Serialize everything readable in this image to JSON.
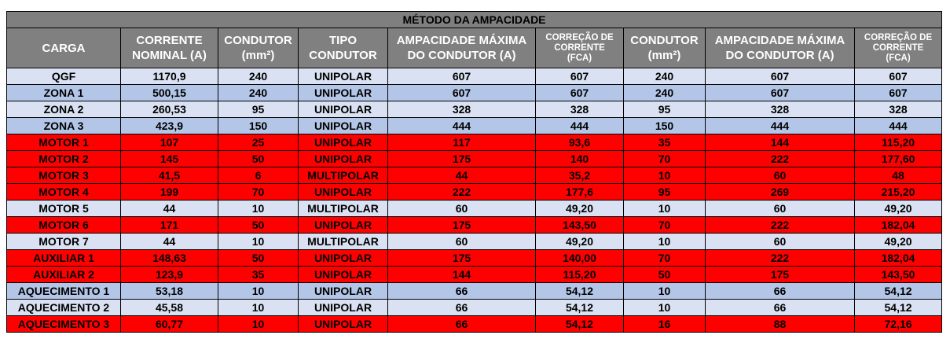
{
  "title": "MÉTODO DA AMPACIDADE",
  "headers": [
    {
      "lines": [
        "CARGA"
      ],
      "small": false
    },
    {
      "lines": [
        "CORRENTE",
        "NOMINAL (A)"
      ],
      "small": false
    },
    {
      "lines": [
        "CONDUTOR",
        "(mm²)"
      ],
      "small": false
    },
    {
      "lines": [
        "TIPO",
        "CONDUTOR"
      ],
      "small": false
    },
    {
      "lines": [
        "AMPACIDADE MÁXIMA",
        "DO CONDUTOR (A)"
      ],
      "small": false
    },
    {
      "lines": [
        "CORREÇÃO DE",
        "CORRENTE",
        "(FCA)"
      ],
      "small": true
    },
    {
      "lines": [
        "CONDUTOR",
        "(mm²)"
      ],
      "small": false
    },
    {
      "lines": [
        "AMPACIDADE MÁXIMA",
        "DO CONDUTOR (A)"
      ],
      "small": false
    },
    {
      "lines": [
        "CORREÇÃO DE",
        "CORRENTE",
        "(FCA)"
      ],
      "small": true
    }
  ],
  "colors": {
    "title_bg": "#7f7f7f",
    "header_bg": "#808080",
    "row_light": "#d9e1f2",
    "row_mid": "#b4c6e7",
    "row_red": "#ff0000"
  },
  "rows": [
    {
      "style": "light",
      "cells": [
        "QGF",
        "1170,9",
        "240",
        "UNIPOLAR",
        "607",
        "607",
        "240",
        "607",
        "607"
      ]
    },
    {
      "style": "mid",
      "cells": [
        "ZONA 1",
        "500,15",
        "240",
        "UNIPOLAR",
        "607",
        "607",
        "240",
        "607",
        "607"
      ]
    },
    {
      "style": "light",
      "cells": [
        "ZONA 2",
        "260,53",
        "95",
        "UNIPOLAR",
        "328",
        "328",
        "95",
        "328",
        "328"
      ]
    },
    {
      "style": "mid",
      "cells": [
        "ZONA 3",
        "423,9",
        "150",
        "UNIPOLAR",
        "444",
        "444",
        "150",
        "444",
        "444"
      ]
    },
    {
      "style": "red",
      "cells": [
        "MOTOR 1",
        "107",
        "25",
        "UNIPOLAR",
        "117",
        "93,6",
        "35",
        "144",
        "115,20"
      ]
    },
    {
      "style": "red",
      "cells": [
        "MOTOR 2",
        "145",
        "50",
        "UNIPOLAR",
        "175",
        "140",
        "70",
        "222",
        "177,60"
      ]
    },
    {
      "style": "red",
      "cells": [
        "MOTOR 3",
        "41,5",
        "6",
        "MULTIPOLAR",
        "44",
        "35,2",
        "10",
        "60",
        "48"
      ]
    },
    {
      "style": "red",
      "cells": [
        "MOTOR 4",
        "199",
        "70",
        "UNIPOLAR",
        "222",
        "177,6",
        "95",
        "269",
        "215,20"
      ]
    },
    {
      "style": "light",
      "cells": [
        "MOTOR 5",
        "44",
        "10",
        "MULTIPOLAR",
        "60",
        "49,20",
        "10",
        "60",
        "49,20"
      ]
    },
    {
      "style": "red",
      "cells": [
        "MOTOR 6",
        "171",
        "50",
        "UNIPOLAR",
        "175",
        "143,50",
        "70",
        "222",
        "182,04"
      ]
    },
    {
      "style": "light",
      "cells": [
        "MOTOR 7",
        "44",
        "10",
        "MULTIPOLAR",
        "60",
        "49,20",
        "10",
        "60",
        "49,20"
      ]
    },
    {
      "style": "red",
      "cells": [
        "AUXILIAR 1",
        "148,63",
        "50",
        "UNIPOLAR",
        "175",
        "140,00",
        "70",
        "222",
        "182,04"
      ]
    },
    {
      "style": "red",
      "cells": [
        "AUXILIAR 2",
        "123,9",
        "35",
        "UNIPOLAR",
        "144",
        "115,20",
        "50",
        "175",
        "143,50"
      ]
    },
    {
      "style": "mid",
      "cells": [
        "AQUECIMENTO 1",
        "53,18",
        "10",
        "UNIPOLAR",
        "66",
        "54,12",
        "10",
        "66",
        "54,12"
      ]
    },
    {
      "style": "light",
      "cells": [
        "AQUECIMENTO 2",
        "45,58",
        "10",
        "UNIPOLAR",
        "66",
        "54,12",
        "10",
        "66",
        "54,12"
      ]
    },
    {
      "style": "red",
      "cells": [
        "AQUECIMENTO 3",
        "60,77",
        "10",
        "UNIPOLAR",
        "66",
        "54,12",
        "16",
        "88",
        "72,16"
      ]
    }
  ]
}
